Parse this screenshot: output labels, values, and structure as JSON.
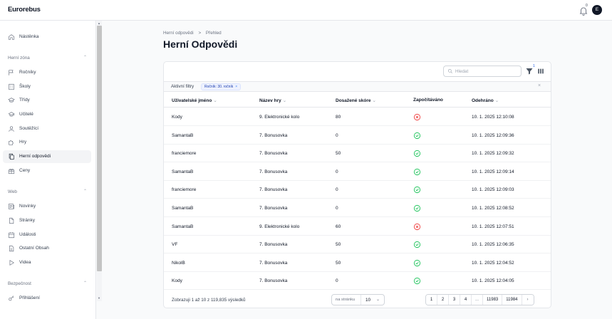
{
  "app": {
    "logo": "Eurorebus",
    "notification_count": "0",
    "avatar_letter": "E"
  },
  "sidebar": {
    "top_items": [
      {
        "label": "Nástěnka",
        "icon": "home-icon"
      }
    ],
    "sections": [
      {
        "title": "Herní zóna",
        "items": [
          {
            "label": "Ročníky",
            "icon": "flag-icon"
          },
          {
            "label": "Školy",
            "icon": "building-icon"
          },
          {
            "label": "Třídy",
            "icon": "graduation-cap-icon"
          },
          {
            "label": "Učitelé",
            "icon": "academic-icon"
          },
          {
            "label": "Soutěžící",
            "icon": "user-icon"
          },
          {
            "label": "Hry",
            "icon": "puzzle-icon"
          },
          {
            "label": "Herní odpovědi",
            "icon": "document-duplicate-icon",
            "active": true
          },
          {
            "label": "Ceny",
            "icon": "gift-icon"
          }
        ]
      },
      {
        "title": "Web",
        "items": [
          {
            "label": "Novinky",
            "icon": "newspaper-icon"
          },
          {
            "label": "Stránky",
            "icon": "document-icon"
          },
          {
            "label": "Události",
            "icon": "calendar-icon"
          },
          {
            "label": "Ostatní Obsah",
            "icon": "document-text-icon"
          },
          {
            "label": "Videa",
            "icon": "play-icon"
          }
        ]
      },
      {
        "title": "Bezpečnost",
        "items": [
          {
            "label": "Přihlášení",
            "icon": "key-icon"
          }
        ]
      }
    ]
  },
  "breadcrumb": {
    "parent": "Herní odpovědi",
    "separator": ">",
    "current": "Přehled"
  },
  "page_title": "Herní Odpovědi",
  "toolbar": {
    "search_placeholder": "Hledat",
    "filter_count": "1"
  },
  "filters": {
    "label": "Aktivní filtry",
    "chip": "Ročník: 30. ročník",
    "chip_remove": "×",
    "clear": "×"
  },
  "table": {
    "columns": [
      "Uživatelské jméno",
      "Název hry",
      "Dosažené skóre",
      "Započítáváno",
      "Odehráno"
    ],
    "sortable": [
      true,
      true,
      true,
      false,
      true
    ],
    "rows": [
      {
        "user": "Kody",
        "game": "9. Elektronické kolo",
        "score": "80",
        "counted": false,
        "played": "10. 1. 2025 12:10:08"
      },
      {
        "user": "SamantaB",
        "game": "7. Bonusovka",
        "score": "0",
        "counted": true,
        "played": "10. 1. 2025 12:09:36"
      },
      {
        "user": "franciemore",
        "game": "7. Bonusovka",
        "score": "50",
        "counted": true,
        "played": "10. 1. 2025 12:09:32"
      },
      {
        "user": "SamantaB",
        "game": "7. Bonusovka",
        "score": "0",
        "counted": true,
        "played": "10. 1. 2025 12:09:14"
      },
      {
        "user": "franciemore",
        "game": "7. Bonusovka",
        "score": "0",
        "counted": true,
        "played": "10. 1. 2025 12:09:03"
      },
      {
        "user": "SamantaB",
        "game": "7. Bonusovka",
        "score": "0",
        "counted": true,
        "played": "10. 1. 2025 12:08:52"
      },
      {
        "user": "SamantaB",
        "game": "9. Elektronické kolo",
        "score": "60",
        "counted": false,
        "played": "10. 1. 2025 12:07:51"
      },
      {
        "user": "VF",
        "game": "7. Bonusovka",
        "score": "50",
        "counted": true,
        "played": "10. 1. 2025 12:06:35"
      },
      {
        "user": "NikolB",
        "game": "7. Bonusovka",
        "score": "50",
        "counted": true,
        "played": "10. 1. 2025 12:04:52"
      },
      {
        "user": "Kody",
        "game": "7. Bonusovka",
        "score": "0",
        "counted": true,
        "played": "10. 1. 2025 12:04:05"
      }
    ]
  },
  "footer": {
    "summary": "Zobrazuji 1 až 10 z 119,835 výsledků",
    "per_page_label": "na stránku",
    "per_page_value": "10",
    "pages": [
      "1",
      "2",
      "3",
      "4",
      "...",
      "11983",
      "11984",
      "›"
    ]
  },
  "colors": {
    "accent": "#2563eb",
    "success": "#22c55e",
    "danger": "#ef4444"
  }
}
